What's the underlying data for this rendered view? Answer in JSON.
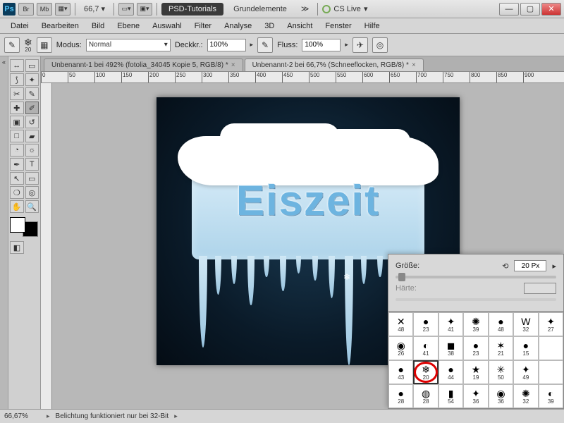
{
  "title_bar": {
    "app_icon": "Ps",
    "buttons": {
      "br": "Br",
      "mb": "Mb"
    },
    "zoom": "66,7",
    "tab_active": "PSD-Tutorials",
    "tab_other": "Grundelemente",
    "cs_live": "CS Live"
  },
  "menu": [
    "Datei",
    "Bearbeiten",
    "Bild",
    "Ebene",
    "Auswahl",
    "Filter",
    "Analyse",
    "3D",
    "Ansicht",
    "Fenster",
    "Hilfe"
  ],
  "options": {
    "brush_size_label": "20",
    "modus_label": "Modus:",
    "modus_value": "Normal",
    "deckkr_label": "Deckkr.:",
    "deckkr_value": "100%",
    "fluss_label": "Fluss:",
    "fluss_value": "100%"
  },
  "doc_tabs": [
    "Unbenannt-1 bei 492% (fotolia_34045 Kopie 5, RGB/8) *",
    "Unbenannt-2 bei 66,7% (Schneeflocken, RGB/8) *"
  ],
  "ruler_ticks": [
    "0",
    "50",
    "100",
    "150",
    "200",
    "250",
    "300",
    "350",
    "400",
    "450",
    "500",
    "550",
    "600",
    "650",
    "700",
    "750",
    "800",
    "850",
    "900"
  ],
  "artwork": {
    "text": "Eiszeit"
  },
  "brush_panel": {
    "size_label": "Größe:",
    "size_value": "20 Px",
    "hardness_label": "Härte:",
    "hardness_value": "",
    "cells": [
      {
        "g": "✕",
        "n": "48"
      },
      {
        "g": "●",
        "n": "23"
      },
      {
        "g": "✦",
        "n": "41"
      },
      {
        "g": "✺",
        "n": "39"
      },
      {
        "g": "●",
        "n": "48"
      },
      {
        "g": "W",
        "n": "32"
      },
      {
        "g": "✦",
        "n": "27"
      },
      {
        "g": "◉",
        "n": "26"
      },
      {
        "g": "◐",
        "n": "41"
      },
      {
        "g": "◼",
        "n": "38"
      },
      {
        "g": "●",
        "n": "23"
      },
      {
        "g": "✶",
        "n": "21"
      },
      {
        "g": "●",
        "n": "15"
      },
      {
        "g": "",
        "n": ""
      },
      {
        "g": "●",
        "n": "43"
      },
      {
        "g": "❄",
        "n": "20",
        "sel": true
      },
      {
        "g": "●",
        "n": "44"
      },
      {
        "g": "★",
        "n": "19"
      },
      {
        "g": "✳",
        "n": "50"
      },
      {
        "g": "✦",
        "n": "49"
      },
      {
        "g": "",
        "n": ""
      },
      {
        "g": "●",
        "n": "28"
      },
      {
        "g": "◍",
        "n": "28"
      },
      {
        "g": "▮",
        "n": "54"
      },
      {
        "g": "✦",
        "n": "36"
      },
      {
        "g": "◉",
        "n": "36"
      },
      {
        "g": "✺",
        "n": "32"
      },
      {
        "g": "◐",
        "n": "39"
      }
    ]
  },
  "status": {
    "zoom": "66,67%",
    "msg": "Belichtung funktioniert nur bei 32-Bit"
  }
}
